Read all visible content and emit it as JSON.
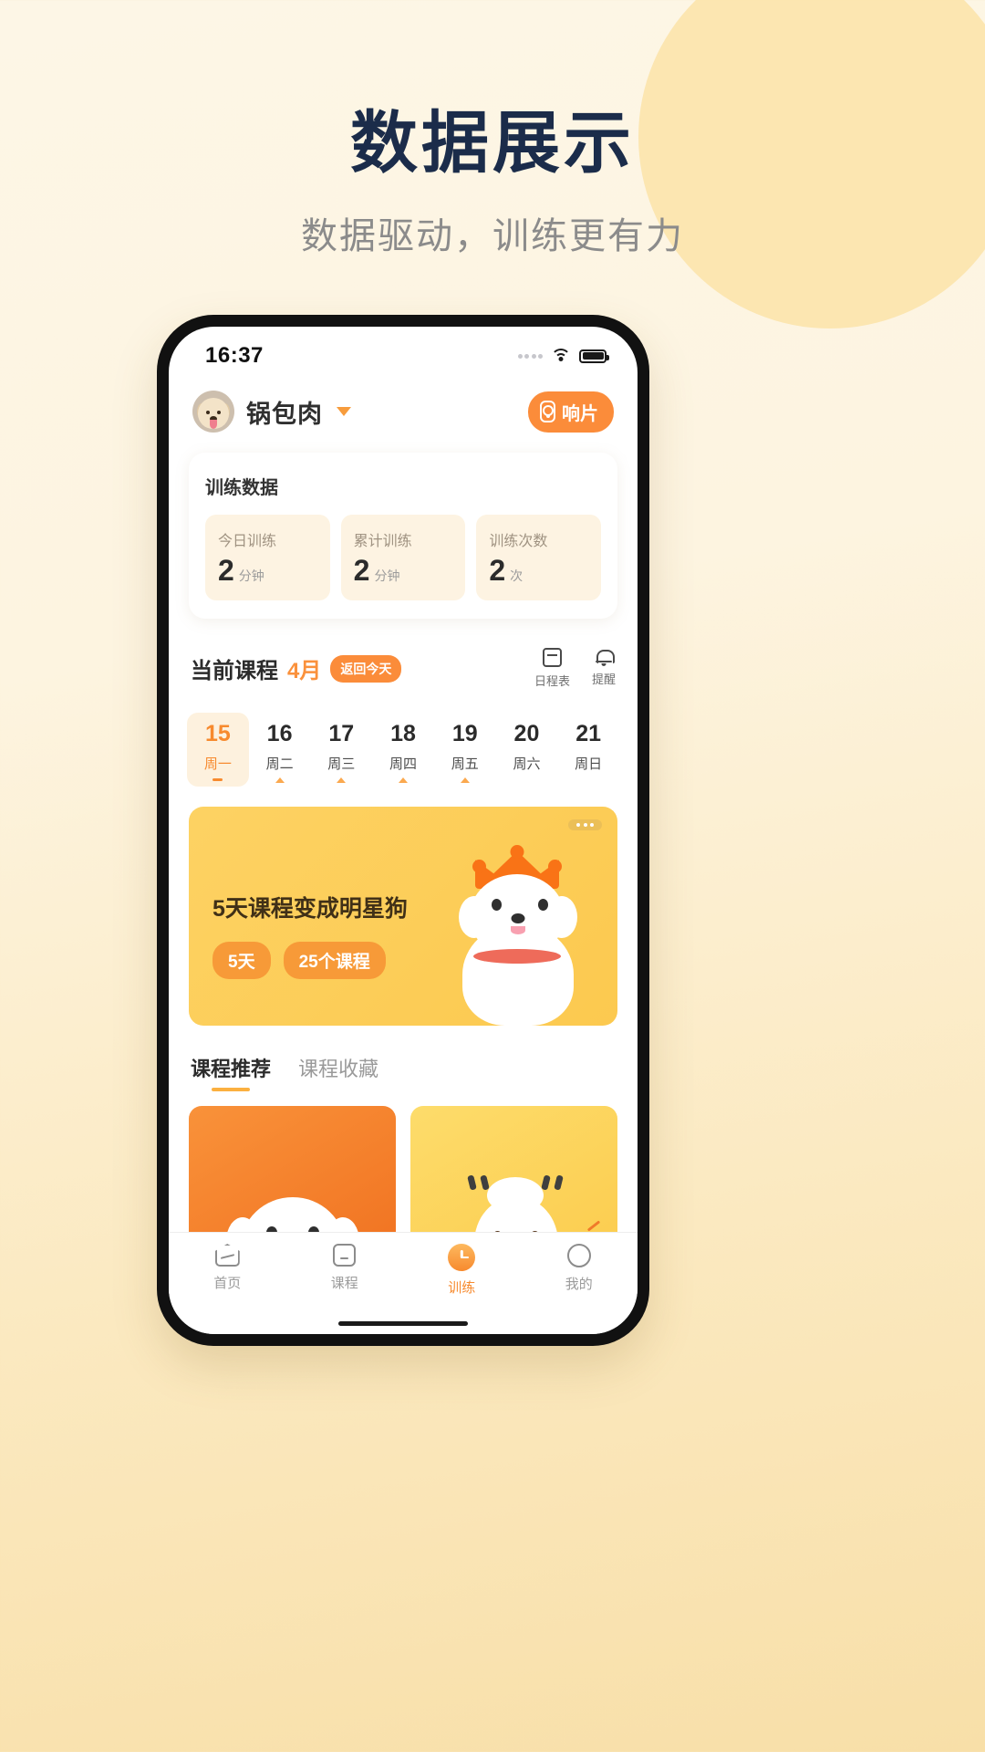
{
  "promo": {
    "title": "数据展示",
    "subtitle": "数据驱动，训练更有力"
  },
  "statusbar": {
    "time": "16:37",
    "signal_icon": "signal-dots-icon",
    "wifi_icon": "wifi-icon",
    "battery_icon": "battery-icon"
  },
  "header": {
    "avatar_name": "pet-avatar",
    "pet_name": "锅包肉",
    "dropdown_icon": "caret-down-icon",
    "clicker_button": {
      "label": "响片",
      "icon": "clicker-device-icon",
      "color": "#fb8c3a"
    }
  },
  "stats": {
    "title": "训练数据",
    "items": [
      {
        "label": "今日训练",
        "value": "2",
        "unit": "分钟"
      },
      {
        "label": "累计训练",
        "value": "2",
        "unit": "分钟"
      },
      {
        "label": "训练次数",
        "value": "2",
        "unit": "次"
      }
    ]
  },
  "course_section": {
    "title": "当前课程",
    "month": "4月",
    "today_badge": "返回今天",
    "actions": [
      {
        "label": "日程表",
        "icon": "calendar-icon"
      },
      {
        "label": "提醒",
        "icon": "bell-icon"
      }
    ]
  },
  "calendar": {
    "days": [
      {
        "num": "15",
        "dow": "周一",
        "active": true,
        "marker": "bar"
      },
      {
        "num": "16",
        "dow": "周二",
        "active": false,
        "marker": "triangle"
      },
      {
        "num": "17",
        "dow": "周三",
        "active": false,
        "marker": "triangle"
      },
      {
        "num": "18",
        "dow": "周四",
        "active": false,
        "marker": "triangle"
      },
      {
        "num": "19",
        "dow": "周五",
        "active": false,
        "marker": "triangle"
      },
      {
        "num": "20",
        "dow": "周六",
        "active": false,
        "marker": "none"
      },
      {
        "num": "21",
        "dow": "周日",
        "active": false,
        "marker": "none"
      }
    ]
  },
  "banner": {
    "title": "5天课程变成明星狗",
    "tags": [
      "5天",
      "25个课程"
    ],
    "more_icon": "more-dots-icon",
    "illustration": "crowned-dog-illustration",
    "bg_color": "#fcca50"
  },
  "rec_tabs": [
    {
      "label": "课程推荐",
      "active": true
    },
    {
      "label": "课程收藏",
      "active": false
    }
  ],
  "course_cards": [
    {
      "illustration": "white-dog-illustration",
      "bg_color": "#f3761f"
    },
    {
      "illustration": "confused-dog-illustration",
      "bg_color": "#fccb4c"
    }
  ],
  "tabbar": [
    {
      "label": "首页",
      "icon": "home-icon",
      "active": false
    },
    {
      "label": "课程",
      "icon": "book-icon",
      "active": false
    },
    {
      "label": "训练",
      "icon": "clock-icon",
      "active": true
    },
    {
      "label": "我的",
      "icon": "person-circle-icon",
      "active": false
    }
  ]
}
